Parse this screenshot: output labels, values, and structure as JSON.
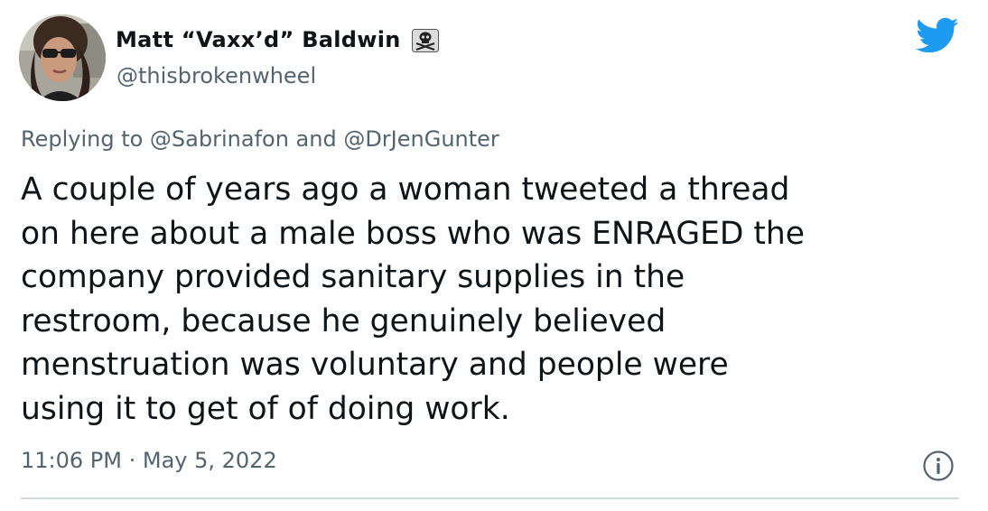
{
  "user": {
    "display_name": "Matt “Vaxx’d” Baldwin",
    "handle": "@thisbrokenwheel",
    "avatar_icon": "user-photo-avatar",
    "badge_icon": "skull-and-crossbones-icon"
  },
  "platform_icon": "twitter-bird-icon",
  "reply_context": "Replying to @Sabrinafon and @DrJenGunter",
  "tweet": {
    "lines": [
      "A couple of years ago a woman tweeted a thread",
      "on here about a male boss who was ENRAGED the",
      "company provided sanitary supplies in the",
      "restroom, because he genuinely believed",
      "menstruation was voluntary and people were",
      "using it to get of of doing work."
    ]
  },
  "timestamp": "11:06 PM · May 5, 2022",
  "colors": {
    "twitter_blue": "#1d9bf0",
    "secondary_text": "#536471",
    "primary_text": "#0f1419",
    "divider": "#cfd9de"
  }
}
